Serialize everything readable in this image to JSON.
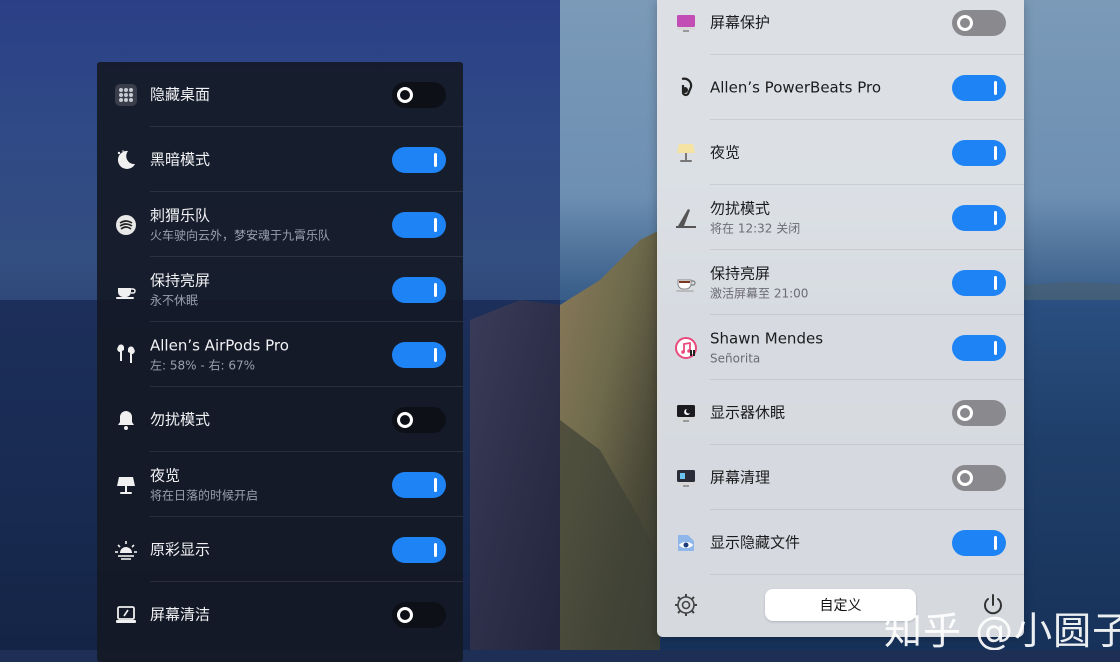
{
  "left_panel": {
    "items": [
      {
        "title": "隐藏桌面",
        "subtitle": "",
        "icon": "grid-icon",
        "on": false
      },
      {
        "title": "黑暗模式",
        "subtitle": "",
        "icon": "moon-icon",
        "on": true
      },
      {
        "title": "刺猬乐队",
        "subtitle": "火车驶向云外，梦安魂于九霄乐队",
        "icon": "music-icon",
        "on": true
      },
      {
        "title": "保持亮屏",
        "subtitle": "永不休眠",
        "icon": "coffee-icon",
        "on": true
      },
      {
        "title": "Allen’s AirPods Pro",
        "subtitle": "左: 58% - 右: 67%",
        "icon": "airpods-icon",
        "on": true
      },
      {
        "title": "勿扰模式",
        "subtitle": "",
        "icon": "bell-icon",
        "on": false
      },
      {
        "title": "夜览",
        "subtitle": "将在日落的时候开启",
        "icon": "lamp-icon",
        "on": true
      },
      {
        "title": "原彩显示",
        "subtitle": "",
        "icon": "sun-icon",
        "on": true
      },
      {
        "title": "屏幕清洁",
        "subtitle": "",
        "icon": "screen-clean-icon",
        "on": false
      }
    ]
  },
  "right_panel": {
    "items": [
      {
        "title": "屏幕保护",
        "subtitle": "",
        "icon": "screensaver-icon",
        "on": false
      },
      {
        "title": "Allen’s PowerBeats Pro",
        "subtitle": "",
        "icon": "earphone-icon",
        "on": true
      },
      {
        "title": "夜览",
        "subtitle": "",
        "icon": "lamp-icon",
        "on": true
      },
      {
        "title": "勿扰模式",
        "subtitle": "将在 12:32 关闭",
        "icon": "dnd-icon",
        "on": true
      },
      {
        "title": "保持亮屏",
        "subtitle": "激活屏幕至 21:00",
        "icon": "coffee-icon",
        "on": true
      },
      {
        "title": "Shawn Mendes",
        "subtitle": "Señorita",
        "icon": "itunes-icon",
        "on": true
      },
      {
        "title": "显示器休眠",
        "subtitle": "",
        "icon": "display-sleep-icon",
        "on": false
      },
      {
        "title": "屏幕清理",
        "subtitle": "",
        "icon": "screen-clean-icon",
        "on": false
      },
      {
        "title": "显示隐藏文件",
        "subtitle": "",
        "icon": "eye-file-icon",
        "on": true
      }
    ],
    "footer": {
      "customize_label": "自定义",
      "settings_icon": "gear-icon",
      "power_icon": "power-icon"
    }
  },
  "watermark": "知乎 @小圆子",
  "colors": {
    "toggle_on": "#1e84f5",
    "dark_panel": "#141824",
    "light_panel": "#e2e4e8"
  }
}
